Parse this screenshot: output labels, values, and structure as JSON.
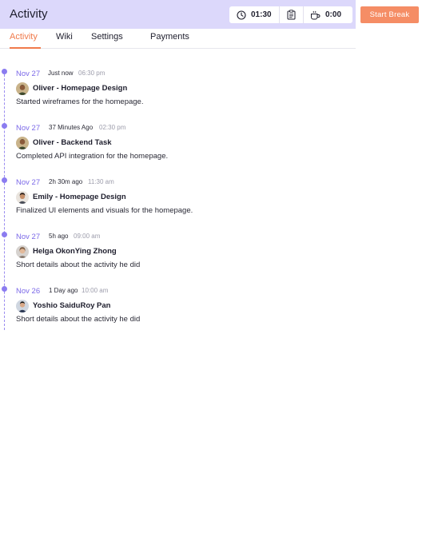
{
  "header": {
    "title": "Activity",
    "timer_icon": "clock-icon",
    "timer_value": "01:30",
    "tasks_icon": "clipboard-icon",
    "break_icon": "coffee-cup-icon",
    "break_value": "0:00",
    "start_break_label": "Start Break",
    "colors": {
      "header_bg": "#dcd8fb",
      "accent": "#f58d65",
      "timeline": "#8b7cf0"
    }
  },
  "tabs": [
    {
      "label": "Activity",
      "active": true
    },
    {
      "label": "Wiki",
      "active": false
    },
    {
      "label": "Settings",
      "active": false
    },
    {
      "label": "Payments",
      "active": false
    }
  ],
  "activities": [
    {
      "date": "Nov 27",
      "ago": "Just now",
      "time": "06:30 pm",
      "user": "Oliver",
      "title": "Oliver - Homepage Design",
      "description": "Started wireframes for the homepage."
    },
    {
      "date": "Nov 27",
      "ago": "37 Minutes Ago",
      "time": "02:30 pm",
      "user": "Oliver",
      "title": "Oliver - Backend Task",
      "description": "Completed API integration for the homepage."
    },
    {
      "date": "Nov 27",
      "ago": "2h 30m ago",
      "time": "11:30 am",
      "user": "Emily",
      "title": "Emily - Homepage Design",
      "description": "Finalized UI elements and visuals for the homepage."
    },
    {
      "date": "Nov 27",
      "ago": "5h ago",
      "time": "09:00 am",
      "user": "Helga",
      "title": "Helga OkonYing Zhong",
      "description": "Short details about the activity he did"
    },
    {
      "date": "Nov 26",
      "ago": "1 Day ago",
      "time": "10:00 am",
      "user": "Yoshio",
      "title": "Yoshio SaiduRoy Pan",
      "description": "Short details about the activity he did"
    }
  ]
}
